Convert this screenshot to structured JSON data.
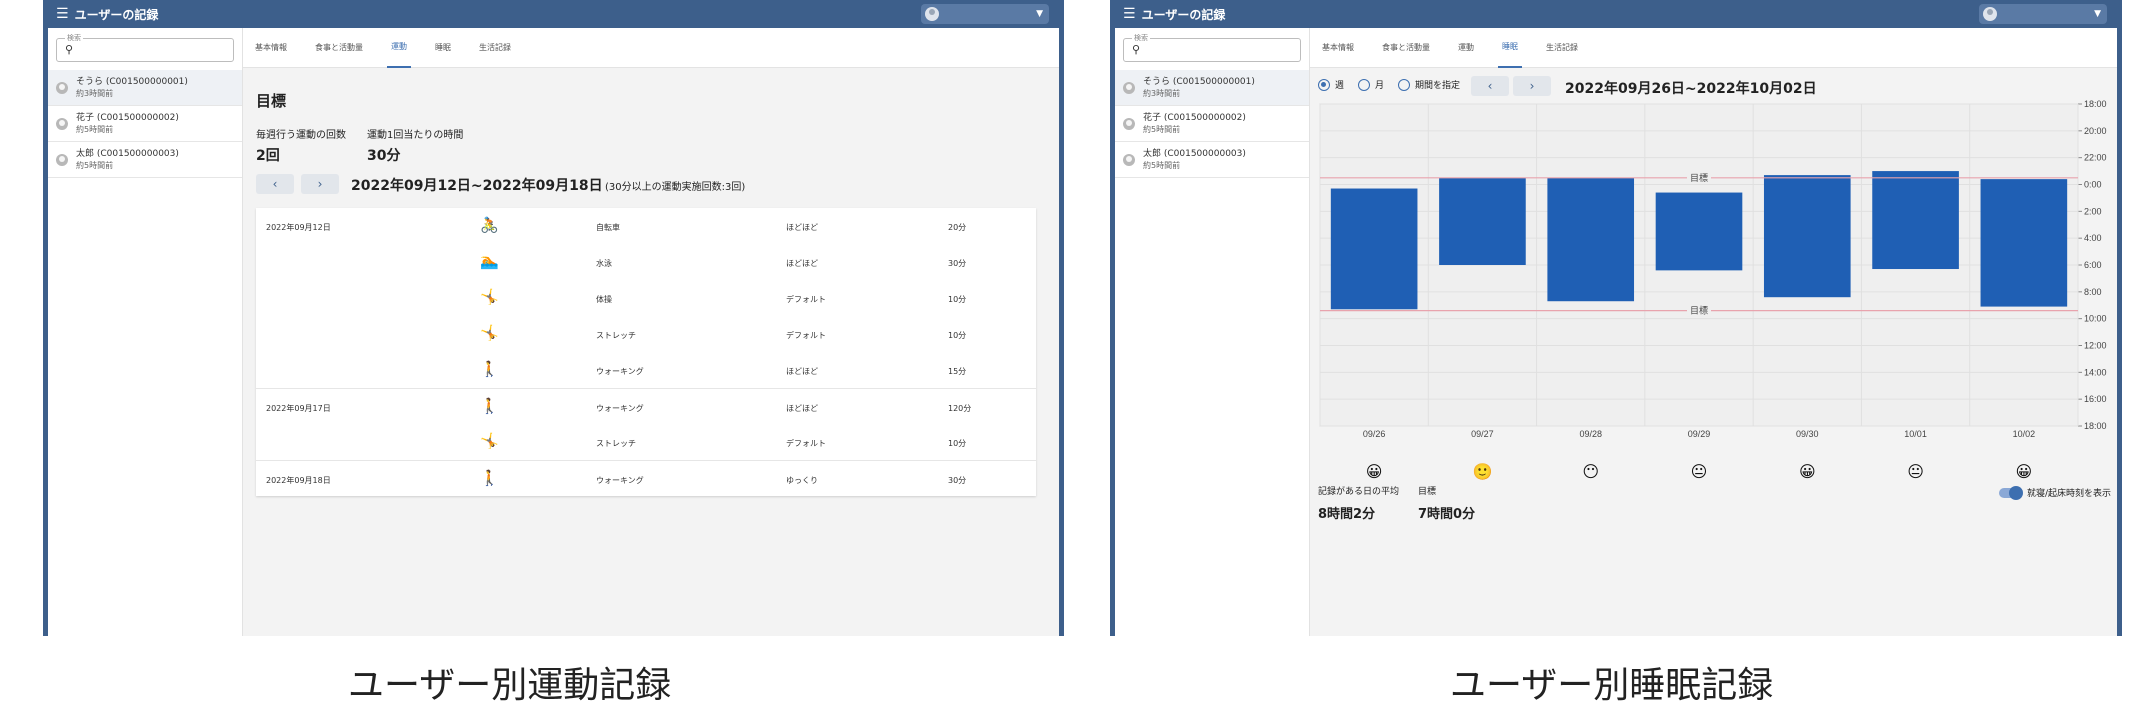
{
  "app": {
    "title": "ユーザーの記録"
  },
  "search": {
    "label": "検索"
  },
  "users": [
    {
      "name": "そうら (C001500000001)",
      "time": "約3時間前"
    },
    {
      "name": "花子 (C001500000002)",
      "time": "約5時間前"
    },
    {
      "name": "太郎 (C001500000003)",
      "time": "約5時間前"
    }
  ],
  "tabs": [
    "基本情報",
    "食事と活動量",
    "運動",
    "睡眠",
    "生活記録"
  ],
  "exercise": {
    "section_title": "目標",
    "goal1_label": "毎週行う運動の回数",
    "goal1_value": "2回",
    "goal2_label": "運動1回当たりの時間",
    "goal2_value": "30分",
    "prev": "‹",
    "next": "›",
    "range": "2022年09月12日~2022年09月18日",
    "range_note": "(30分以上の運動実施回数:3回)",
    "rows": [
      {
        "date": "2022年09月12日",
        "icon": "bicycle-icon",
        "glyph": "🚴",
        "activity": "自転車",
        "intensity": "ほどほど",
        "duration": "20分"
      },
      {
        "date": "",
        "icon": "swimming-icon",
        "glyph": "🏊",
        "activity": "水泳",
        "intensity": "ほどほど",
        "duration": "30分"
      },
      {
        "date": "",
        "icon": "exercise-icon",
        "glyph": "🤸",
        "activity": "体操",
        "intensity": "デフォルト",
        "duration": "10分"
      },
      {
        "date": "",
        "icon": "stretch-icon",
        "glyph": "🤸",
        "activity": "ストレッチ",
        "intensity": "デフォルト",
        "duration": "10分"
      },
      {
        "date": "",
        "icon": "walking-icon",
        "glyph": "🚶",
        "activity": "ウォーキング",
        "intensity": "ほどほど",
        "duration": "15分"
      },
      {
        "date": "2022年09月17日",
        "icon": "walking-icon",
        "glyph": "🚶",
        "activity": "ウォーキング",
        "intensity": "ほどほど",
        "duration": "120分"
      },
      {
        "date": "",
        "icon": "stretch-icon",
        "glyph": "🤸",
        "activity": "ストレッチ",
        "intensity": "デフォルト",
        "duration": "10分"
      },
      {
        "date": "2022年09月18日",
        "icon": "walking-icon",
        "glyph": "🚶",
        "activity": "ウォーキング",
        "intensity": "ゆっくり",
        "duration": "30分"
      }
    ]
  },
  "sleep": {
    "radio_week": "週",
    "radio_month": "月",
    "radio_period": "期間を指定",
    "prev": "‹",
    "next": "›",
    "range": "2022年09月26日~2022年10月02日",
    "goal_label": "目標",
    "faces": [
      "😀",
      "🙂",
      "😶",
      "😐",
      "😀",
      "😐",
      "😀"
    ],
    "avg_label": "記録がある日の平均",
    "avg_value": "8時間2分",
    "target_label": "目標",
    "target_value": "7時間0分",
    "toggle_label": "就寝/起床時刻を表示"
  },
  "chart_data": {
    "type": "bar",
    "categories": [
      "09/26",
      "09/27",
      "09/28",
      "09/29",
      "09/30",
      "10/01",
      "10/02"
    ],
    "series": [
      {
        "start": [
          0.3,
          -0.5,
          -0.5,
          0.6,
          -0.7,
          -1.0,
          -0.4
        ],
        "end": [
          9.3,
          6.0,
          8.7,
          6.4,
          8.4,
          6.3,
          9.1
        ]
      }
    ],
    "goal_lines": [
      -0.5,
      9.4
    ],
    "yticks": [
      "18:00",
      "20:00",
      "22:00",
      "0:00",
      "2:00",
      "4:00",
      "6:00",
      "8:00",
      "10:00",
      "12:00",
      "14:00",
      "16:00",
      "18:00"
    ],
    "ylim": [
      -6,
      18
    ],
    "bar_color": "#1f5fb4",
    "goal_color": "#e8a3ad"
  },
  "captions": {
    "left": "ユーザー別運動記録",
    "right": "ユーザー別睡眠記録"
  }
}
